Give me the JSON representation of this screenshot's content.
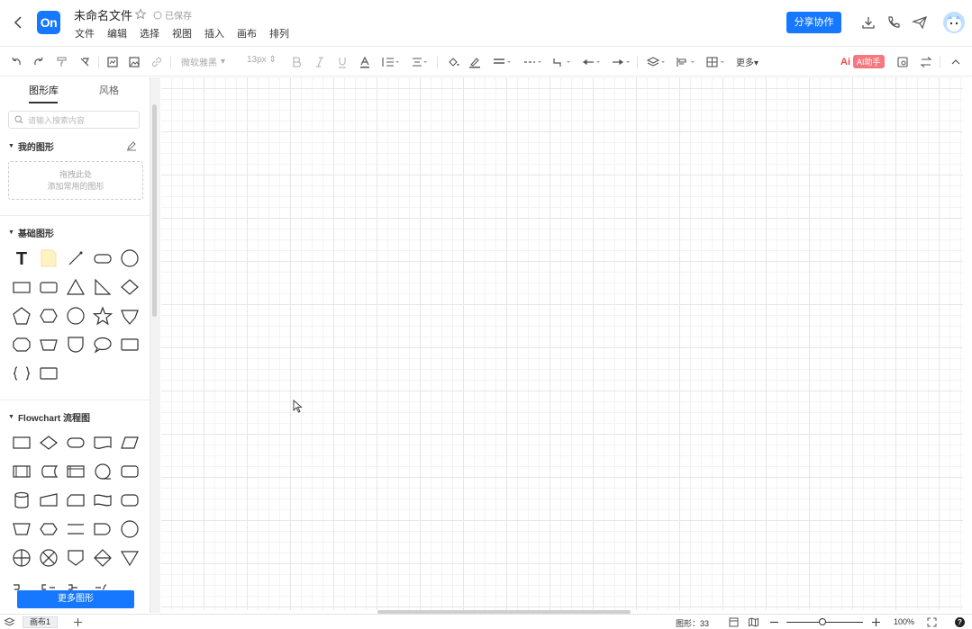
{
  "header": {
    "logo_text": "On",
    "title": "未命名文件",
    "save_status": "已保存",
    "menu": [
      "文件",
      "编辑",
      "选择",
      "视图",
      "插入",
      "画布",
      "排列"
    ],
    "share_label": "分享协作"
  },
  "toolbar": {
    "font": "微软雅黑",
    "font_size": "13px",
    "more_label": "更多",
    "ai_label": "AI助手"
  },
  "sidebar": {
    "tabs": [
      "图形库",
      "风格"
    ],
    "search_placeholder": "请输入搜索内容",
    "my_shapes": {
      "title": "我的图形",
      "drop_line1": "拖拽此处",
      "drop_line2": "添加常用的图形"
    },
    "basic_title": "基础图形",
    "flowchart_title": "Flowchart 流程图",
    "more_shapes_label": "更多图形"
  },
  "statusbar": {
    "page_tab": "画布1",
    "shape_count": "图形：33",
    "zoom": "100%"
  },
  "colors": {
    "accent": "#1677ff",
    "ai": "#f4787f"
  }
}
